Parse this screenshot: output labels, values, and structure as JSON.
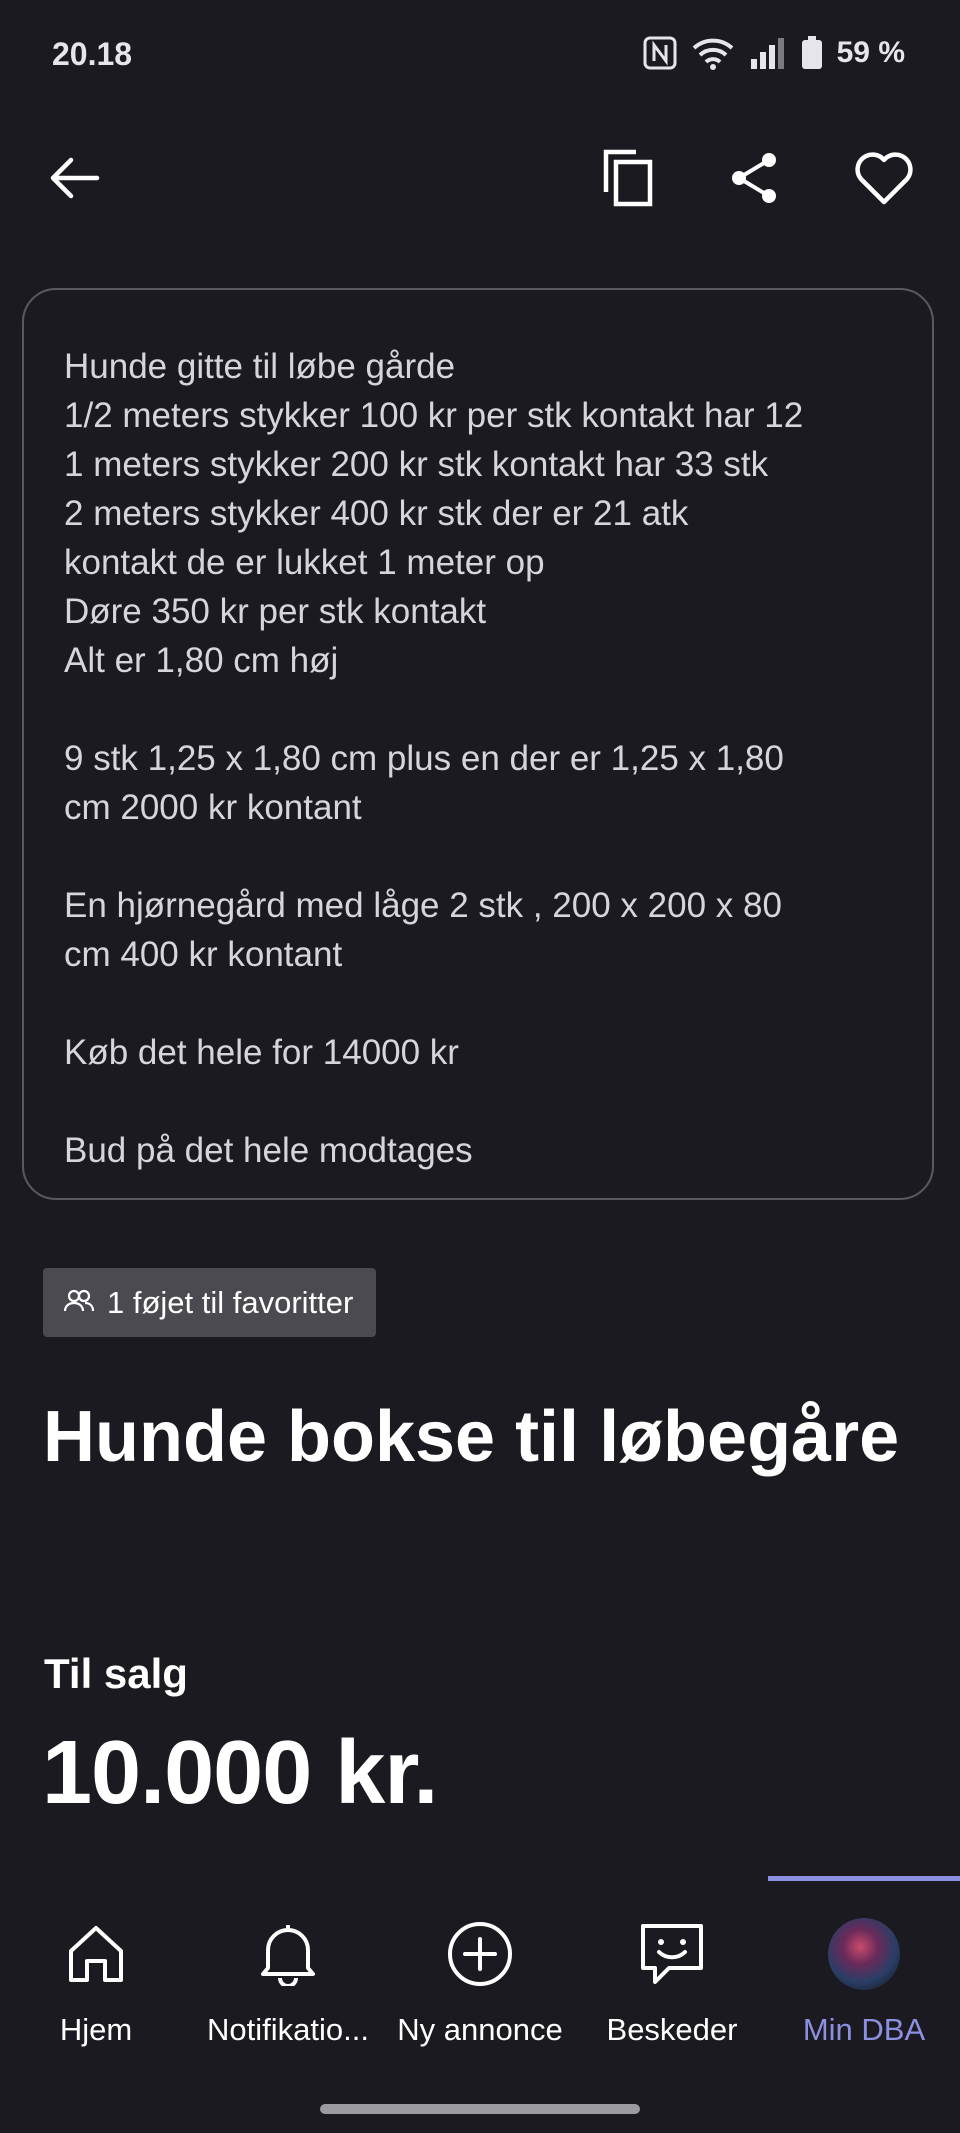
{
  "status_bar": {
    "time": "20.18",
    "battery": "59 %",
    "icons": [
      "nfc-icon",
      "wifi-icon",
      "signal-icon",
      "battery-icon"
    ]
  },
  "top_bar": {
    "icons": [
      "back-arrow-icon",
      "copy-icon",
      "share-icon",
      "heart-icon"
    ]
  },
  "description": "Hunde gitte til løbe gårde\n1/2 meters stykker 100 kr per stk kontakt har 12\n1 meters stykker 200 kr stk kontakt har 33 stk\n2 meters stykker 400 kr stk der er 21 atk\nkontakt de er lukket 1 meter op\nDøre 350 kr per stk kontakt\nAlt er 1,80 cm høj\n\n9 stk 1,25 x 1,80 cm plus en der er 1,25 x 1,80\ncm 2000 kr kontant\n\nEn hjørnegård med låge 2 stk , 200 x 200 x 80\ncm 400 kr kontant\n\nKøb det hele for 14000 kr\n\nBud på det hele modtages",
  "favorites_chip": "1 føjet til favoritter",
  "listing": {
    "title": "Hunde bokse til løbegåre",
    "sale_label": "Til salg",
    "price": "10.000 kr."
  },
  "bottom_nav": {
    "items": [
      {
        "label": "Hjem",
        "icon": "home-icon"
      },
      {
        "label": "Notifikatio...",
        "icon": "bell-icon"
      },
      {
        "label": "Ny annonce",
        "icon": "plus-circle-icon"
      },
      {
        "label": "Beskeder",
        "icon": "chat-icon"
      },
      {
        "label": "Min DBA",
        "icon": "avatar"
      }
    ],
    "active": "Min DBA"
  },
  "colors": {
    "background": "#1b1a21",
    "accent": "#8d8fe0",
    "chip": "#4b4a51"
  }
}
